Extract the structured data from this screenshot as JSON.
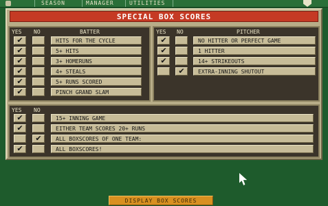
{
  "menubar": {
    "items": [
      {
        "label": "SEASON"
      },
      {
        "label": "MANAGER"
      },
      {
        "label": "UTILITIES"
      }
    ]
  },
  "title": "SPECIAL BOX SCORES",
  "batter_box": {
    "yes_header": "YES",
    "no_header": "NO",
    "label_header": "BATTER",
    "rows": [
      {
        "label": "HITS FOR THE CYCLE",
        "yes": "✔",
        "no": ""
      },
      {
        "label": "5+ HITS",
        "yes": "✔",
        "no": ""
      },
      {
        "label": "3+ HOMERUNS",
        "yes": "✔",
        "no": ""
      },
      {
        "label": "4+ STEALS",
        "yes": "✔",
        "no": ""
      },
      {
        "label": "5+ RUNS SCORED",
        "yes": "✔",
        "no": ""
      },
      {
        "label": "PINCH GRAND SLAM",
        "yes": "✔",
        "no": ""
      }
    ]
  },
  "pitcher_box": {
    "yes_header": "YES",
    "no_header": "NO",
    "label_header": "PITCHER",
    "rows": [
      {
        "label": "NO HITTER OR PERFECT GAME",
        "yes": "✔",
        "no": ""
      },
      {
        "label": "1 HITTER",
        "yes": "✔",
        "no": ""
      },
      {
        "label": "14+ STRIKEOUTS",
        "yes": "✔",
        "no": ""
      },
      {
        "label": "EXTRA-INNING SHUTOUT",
        "yes": "",
        "no": "✔"
      }
    ]
  },
  "game_box": {
    "yes_header": "YES",
    "no_header": "NO",
    "rows": [
      {
        "label": "15+ INNING GAME",
        "yes": "✔",
        "no": ""
      },
      {
        "label": "EITHER TEAM SCORES 20+ RUNS",
        "yes": "✔",
        "no": ""
      },
      {
        "label": "ALL BOXSCORES OF ONE TEAM:",
        "yes": "",
        "no": "✔"
      },
      {
        "label": "ALL BOXSCORES!",
        "yes": "✔",
        "no": ""
      }
    ]
  },
  "display_button_label": "DISPLAY BOX SCORES",
  "colors": {
    "background": "#1e5b2c",
    "panel": "#b8ad88",
    "title_bar": "#c53a24",
    "display_button": "#d89020"
  }
}
